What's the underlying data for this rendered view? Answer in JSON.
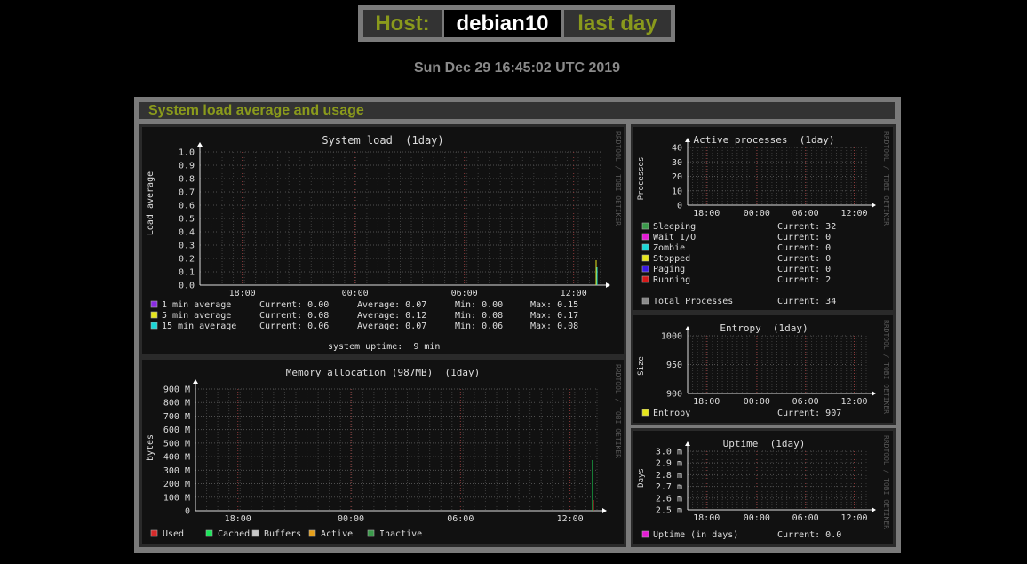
{
  "header": {
    "host_label": "Host:",
    "host_name": "debian10",
    "period": "last day",
    "datetime": "Sun Dec 29 16:45:02 UTC 2019"
  },
  "section": {
    "title": "System load average and usage"
  },
  "watermark": "RRDTOOL / TOBI OETIKER",
  "colors": {
    "accent": "#8a9a1c",
    "frame": "#7a7a7a",
    "panel": "#333333",
    "plot_bg": "#111111"
  },
  "graphs": {
    "load": {
      "title": "System load  (1day)",
      "ylabel": "Load average",
      "yticks": [
        "1.0",
        "0.9",
        "0.8",
        "0.7",
        "0.6",
        "0.5",
        "0.4",
        "0.3",
        "0.2",
        "0.1",
        "0.0"
      ],
      "xticks": [
        "18:00",
        "00:00",
        "06:00",
        "12:00"
      ],
      "legend": [
        {
          "color": "#8a2be2",
          "label": " 1 min average",
          "current": "Current: 0.00",
          "average": "Average: 0.07",
          "min": "Min: 0.00",
          "max": "Max: 0.15"
        },
        {
          "color": "#e6e61a",
          "label": " 5 min average",
          "current": "Current: 0.08",
          "average": "Average: 0.12",
          "min": "Min: 0.08",
          "max": "Max: 0.17"
        },
        {
          "color": "#1ad6d6",
          "label": "15 min average",
          "current": "Current: 0.06",
          "average": "Average: 0.07",
          "min": "Min: 0.06",
          "max": "Max: 0.08"
        }
      ],
      "footer": "system uptime:  9 min"
    },
    "memory": {
      "title": "Memory allocation (987MB)  (1day)",
      "ylabel": "bytes",
      "yticks": [
        "900 M",
        "800 M",
        "700 M",
        "600 M",
        "500 M",
        "400 M",
        "300 M",
        "200 M",
        "100 M",
        "0"
      ],
      "xticks": [
        "18:00",
        "00:00",
        "06:00",
        "12:00"
      ],
      "legend": [
        {
          "color": "#d62a2a",
          "label": "Used"
        },
        {
          "color": "#1ae65a",
          "label": "Cached"
        },
        {
          "color": "#c8c8c8",
          "label": "Buffers"
        },
        {
          "color": "#e6a01a",
          "label": "Active"
        },
        {
          "color": "#3a9a4a",
          "label": "Inactive"
        }
      ]
    },
    "processes": {
      "title": "Active processes  (1day)",
      "ylabel": "Processes",
      "yticks": [
        "40",
        "30",
        "20",
        "10",
        "0"
      ],
      "xticks": [
        "18:00",
        "00:00",
        "06:00",
        "12:00"
      ],
      "legend": [
        {
          "color": "#3a9a4a",
          "label": "Sleeping",
          "current": "Current:   32"
        },
        {
          "color": "#e61ad6",
          "label": "Wait I/O",
          "current": "Current:    0"
        },
        {
          "color": "#1ad6d6",
          "label": "Zombie",
          "current": "Current:    0"
        },
        {
          "color": "#e6e61a",
          "label": "Stopped",
          "current": "Current:    0"
        },
        {
          "color": "#3a1ae6",
          "label": "Paging",
          "current": "Current:    0"
        },
        {
          "color": "#d61a1a",
          "label": "Running",
          "current": "Current:    2"
        }
      ],
      "total": {
        "color": "#8a8a8a",
        "label": "Total Processes",
        "current": "Current:   34"
      }
    },
    "entropy": {
      "title": "Entropy  (1day)",
      "ylabel": "Size",
      "yticks": [
        "1000",
        "950",
        "900"
      ],
      "xticks": [
        "18:00",
        "00:00",
        "06:00",
        "12:00"
      ],
      "legend": [
        {
          "color": "#e6e61a",
          "label": "Entropy",
          "current": "Current:  907"
        }
      ]
    },
    "uptime": {
      "title": "Uptime  (1day)",
      "ylabel": "Days",
      "yticks": [
        "3.0 m",
        "2.9 m",
        "2.8 m",
        "2.7 m",
        "2.6 m",
        "2.5 m"
      ],
      "xticks": [
        "18:00",
        "00:00",
        "06:00",
        "12:00"
      ],
      "legend": [
        {
          "color": "#e61ad6",
          "label": "Uptime  (in days)",
          "current": "Current:  0.0"
        }
      ]
    }
  }
}
